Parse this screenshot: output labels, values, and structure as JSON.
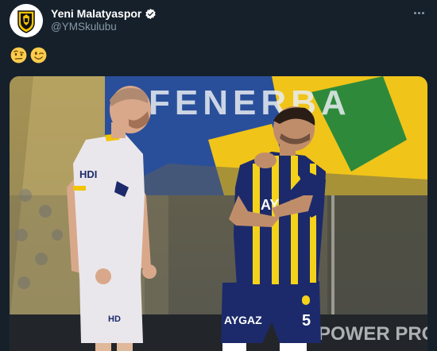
{
  "tweet": {
    "author_name": "Yeni Malatyaspor",
    "handle": "@YMSkulubu",
    "verified": true,
    "emojis": [
      "face-with-raised-eyebrow-emoji",
      "winking-face-emoji"
    ],
    "more_icon": "more-horizontal-icon"
  },
  "media": {
    "banner_text": "FENERBA",
    "left_player_shirt_text": "HDI",
    "left_player_shorts_text": "HD",
    "right_player_shirt_text": "AY",
    "right_player_shorts_text": "AYGAZ",
    "right_player_number": "5",
    "board_text": "POWER PRO"
  },
  "colors": {
    "background": "#15202b",
    "secondary_text": "#8899a6",
    "verified_badge": "#ffffff",
    "fb_navy": "#1c2a6b",
    "fb_yellow": "#f4d21a",
    "ym_kit": "#e9e7ec"
  }
}
